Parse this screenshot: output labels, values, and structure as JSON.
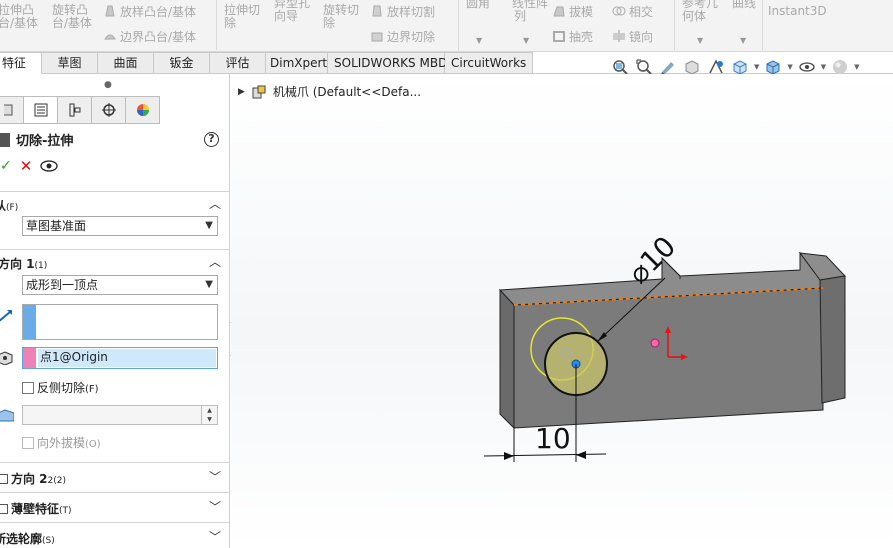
{
  "ribbon": {
    "items": [
      {
        "l1": "拉伸凸",
        "l2": "台/基体"
      },
      {
        "l1": "旋转凸",
        "l2": "台/基体"
      },
      {
        "l1": "放样凸台/基体",
        "l2": "边界凸台/基体"
      },
      {
        "l1": "拉伸切",
        "l2": "除"
      },
      {
        "l1": "异型孔",
        "l2": "向导"
      },
      {
        "l1": "旋转切",
        "l2": "除"
      },
      {
        "l1": "放样切割",
        "l2": "边界切除"
      },
      {
        "l1": "圆角"
      },
      {
        "l1": "线性阵",
        "l2": "列"
      },
      {
        "l1": "拔模",
        "l2": "抽壳"
      },
      {
        "l1": "相交",
        "l2": "镜向"
      },
      {
        "l1": "参考几",
        "l2": "何体"
      },
      {
        "l1": "曲线"
      },
      {
        "l1": "Instant3D"
      }
    ]
  },
  "tabs": [
    "特征",
    "草图",
    "曲面",
    "钣金",
    "评估",
    "DimXpert",
    "SOLIDWORKS MBD",
    "CircuitWorks"
  ],
  "tree": {
    "root": "机械爪  (Default<<Defa..."
  },
  "feature": {
    "title": "切除-拉伸",
    "from_label": "从",
    "from_key": "(F)",
    "from_value": "草图基准面",
    "dir1_label": "方向 1",
    "dir1_key": "(1)",
    "end_condition": "成形到一顶点",
    "vertex_value": "点1@Origin",
    "flip_side_label": "反侧切除",
    "flip_side_key": "(F)",
    "draft_outward_label": "向外拔模",
    "draft_outward_key": "(O)",
    "dir2_label": "方向 2",
    "dir2_key": "2(2)",
    "thin_label": "薄壁特征",
    "thin_key": "(T)",
    "contour_label": "所选轮廓",
    "contour_key": "(S)"
  },
  "dims": {
    "diameter": "⌀10",
    "distance": "10"
  },
  "colors": {
    "ok": "#2a9d2a",
    "cancel": "#d11111",
    "select_hl": "#cfe8fb",
    "part": "#808080",
    "preview": "#e6e68a"
  }
}
